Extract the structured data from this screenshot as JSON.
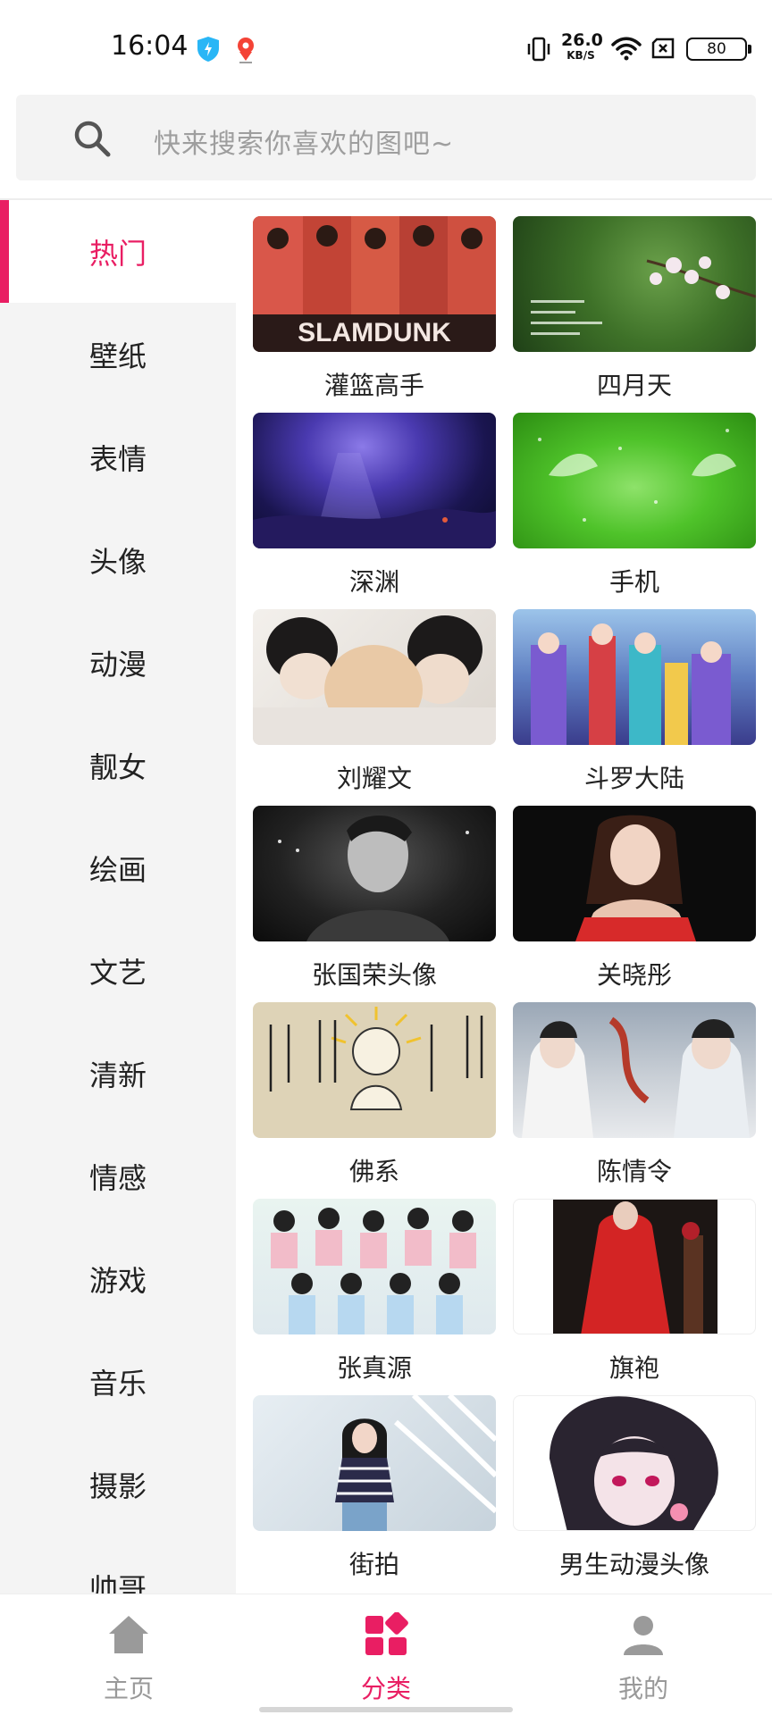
{
  "status_bar": {
    "time": "16:04",
    "net_speed_value": "26.0",
    "net_speed_unit": "KB/S",
    "battery": "80",
    "icons": [
      "shield-icon",
      "location-pin-icon",
      "vibrate-icon",
      "wifi-icon",
      "sim-off-icon",
      "battery-icon"
    ]
  },
  "search": {
    "placeholder": "快来搜索你喜欢的图吧~"
  },
  "sidebar": {
    "items": [
      {
        "label": "热门",
        "active": true
      },
      {
        "label": "壁纸"
      },
      {
        "label": "表情"
      },
      {
        "label": "头像"
      },
      {
        "label": "动漫"
      },
      {
        "label": "靓女"
      },
      {
        "label": "绘画"
      },
      {
        "label": "文艺"
      },
      {
        "label": "清新"
      },
      {
        "label": "情感"
      },
      {
        "label": "游戏"
      },
      {
        "label": "音乐"
      },
      {
        "label": "摄影"
      },
      {
        "label": "帅哥"
      }
    ]
  },
  "grid": {
    "items": [
      {
        "title": "灌篮高手"
      },
      {
        "title": "四月天"
      },
      {
        "title": "深渊"
      },
      {
        "title": "手机"
      },
      {
        "title": "刘耀文"
      },
      {
        "title": "斗罗大陆"
      },
      {
        "title": "张国荣头像"
      },
      {
        "title": "关晓彤"
      },
      {
        "title": "佛系"
      },
      {
        "title": "陈情令"
      },
      {
        "title": "张真源"
      },
      {
        "title": "旗袍"
      },
      {
        "title": "街拍"
      },
      {
        "title": "男生动漫头像"
      }
    ]
  },
  "bottom_nav": {
    "items": [
      {
        "label": "主页",
        "icon": "home-icon"
      },
      {
        "label": "分类",
        "icon": "category-icon",
        "active": true
      },
      {
        "label": "我的",
        "icon": "profile-icon"
      }
    ]
  },
  "colors": {
    "accent": "#e91e63",
    "sidebar_bg": "#f4f4f4",
    "search_bg": "#f3f3f3"
  }
}
